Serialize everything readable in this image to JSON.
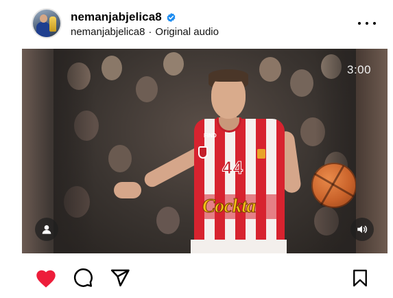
{
  "post": {
    "username": "nemanjabjelica8",
    "verified": true,
    "audio_owner": "nemanjabjelica8",
    "separator": "·",
    "audio_label": "Original audio"
  },
  "video": {
    "duration": "3:00",
    "jersey_number": "44",
    "sponsor_text": "Cockta",
    "brand_text": "FIND"
  },
  "actions": {
    "liked": true,
    "icons": [
      "heart-icon",
      "comment-icon",
      "share-icon",
      "bookmark-icon"
    ]
  },
  "colors": {
    "like_red": "#ed1d3a",
    "verified_blue": "#1d8cf0"
  }
}
